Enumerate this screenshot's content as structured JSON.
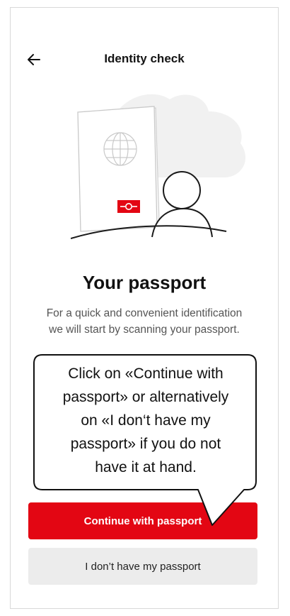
{
  "header": {
    "title": "Identity check",
    "back_icon": "arrow-left-icon"
  },
  "illustration": {
    "name": "passport-person-illustration",
    "accent_color": "#e30613"
  },
  "main": {
    "headline": "Your passport",
    "subtext_lines": [
      "For a quick and convenient identification",
      "we will start by scanning your passport."
    ]
  },
  "buttons": {
    "primary_label": "Continue with passport",
    "primary_color": "#e30613",
    "secondary_label": "I don’t have my passport"
  },
  "callout": {
    "lines": [
      "Click on «Continue with",
      "passport» or alternatively",
      "on «I don‘t have my",
      "passport» if you do not",
      "have it at hand."
    ]
  }
}
